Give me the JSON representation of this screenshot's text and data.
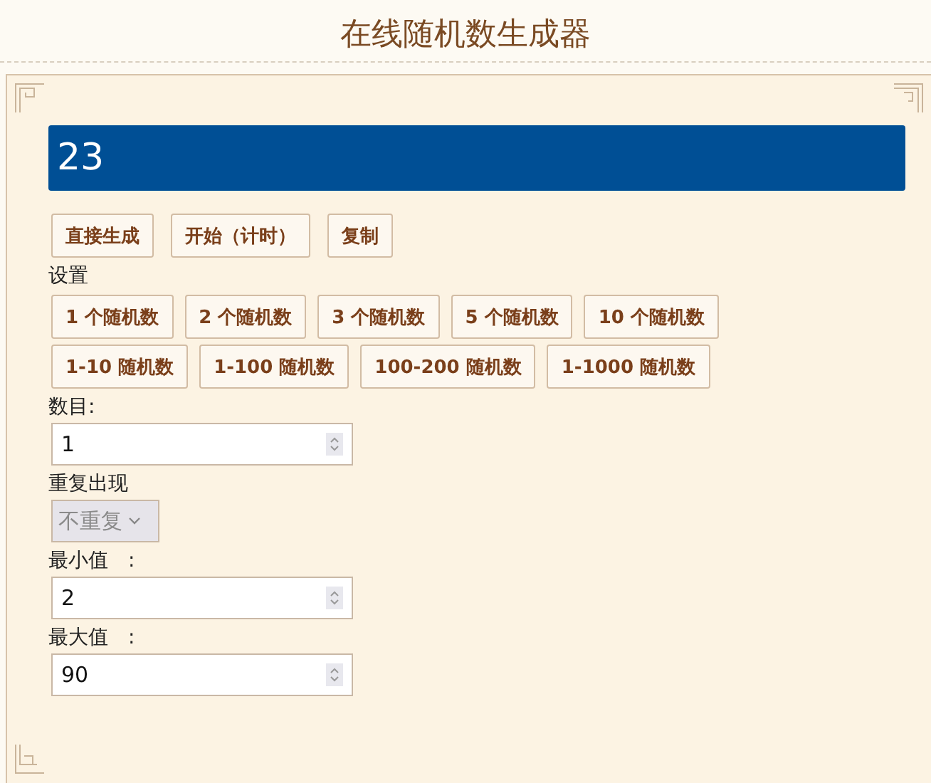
{
  "title": "在线随机数生成器",
  "result": "23",
  "actions": [
    "直接生成",
    "开始（计时）",
    "复制"
  ],
  "settings_label": "设置",
  "presets_row_1": [
    "1 个随机数",
    "2 个随机数",
    "3 个随机数",
    "5 个随机数",
    "10 个随机数"
  ],
  "presets_row_2": [
    "1-10 随机数",
    "1-100 随机数",
    "100-200 随机数",
    "1-1000 随机数"
  ],
  "fields": [
    {
      "kind": "number",
      "label": "数目:",
      "value": "1"
    },
    {
      "kind": "select",
      "label": "重复出现",
      "value": "不重复",
      "disabled": true
    },
    {
      "kind": "number",
      "label": "最小值　:",
      "value": "2"
    },
    {
      "kind": "number",
      "label": "最大值　:",
      "value": "90"
    }
  ]
}
